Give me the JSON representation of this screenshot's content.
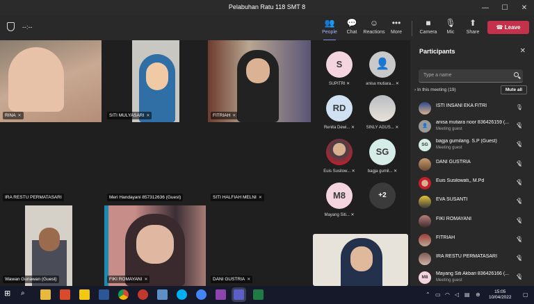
{
  "window": {
    "title": "Pelabuhan Ratu 118 SMT 8"
  },
  "toolbar": {
    "timer": "--:--",
    "people_label": "People",
    "chat_label": "Chat",
    "reactions_label": "Reactions",
    "more_label": "More",
    "camera_label": "Camera",
    "mic_label": "Mic",
    "share_label": "Share",
    "leave_label": "Leave"
  },
  "grid": {
    "tiles": [
      {
        "name": "RINA"
      },
      {
        "name": "SITI MULYASARI"
      },
      {
        "name": "FITRIAH"
      },
      {
        "name": "IRA RESTU PERMATASARI"
      },
      {
        "name": "Meri Handayani 857312636 (Guest)"
      },
      {
        "name": "SITI HALFIAH MELNI"
      },
      {
        "name": "Wawan Gunawan (Guest)"
      },
      {
        "name": "FIKI ROMAYANI"
      },
      {
        "name": "DANI GUSTRIA"
      }
    ]
  },
  "avatars": [
    {
      "initials": "S",
      "name": "SUPITRI",
      "color": "#f3d4df"
    },
    {
      "initials": "",
      "name": "anisa mutiara...",
      "color": "#c9c9c9"
    },
    {
      "initials": "RD",
      "name": "Renita Dewi...",
      "color": "#cfe1f3"
    },
    {
      "initials": "",
      "name": "SINLY AGUS...",
      "color": "#c9c9c9"
    },
    {
      "initials": "",
      "name": "Euis Susilow...",
      "color": "#c9c9c9"
    },
    {
      "initials": "SG",
      "name": "bagja gumil...",
      "color": "#d6ece6"
    },
    {
      "initials": "M8",
      "name": "Mayang Siti...",
      "color": "#f3d4df"
    },
    {
      "initials": "+2",
      "name": "",
      "color": "#3b3b3b"
    }
  ],
  "panel": {
    "title": "Participants",
    "search_placeholder": "Type a name",
    "section_label": "In this meeting (19)",
    "mute_all_label": "Mute all",
    "participants": [
      {
        "name": "ISTI INSANI EKA FITRI",
        "sub": "",
        "initials": "",
        "mic": "on"
      },
      {
        "name": "anisa mutiara noor 836426159 (...",
        "sub": "Meeting guest",
        "initials": "",
        "mic": "off"
      },
      {
        "name": "bagja gumilang. S.P (Guest)",
        "sub": "Meeting guest",
        "initials": "SG",
        "mic": "off"
      },
      {
        "name": "DANI GUSTRIA",
        "sub": "",
        "initials": "",
        "mic": "off"
      },
      {
        "name": "Euis Susilowati,, M.Pd",
        "sub": "",
        "initials": "",
        "mic": "off"
      },
      {
        "name": "EVA SUSANTI",
        "sub": "",
        "initials": "",
        "mic": "off"
      },
      {
        "name": "FIKI ROMAYANI",
        "sub": "",
        "initials": "",
        "mic": "off"
      },
      {
        "name": "FITRIAH",
        "sub": "",
        "initials": "",
        "mic": "off"
      },
      {
        "name": "IRA RESTU PERMATASARI",
        "sub": "",
        "initials": "",
        "mic": "off"
      },
      {
        "name": "Mayang Siti Akbari 836426166 (...",
        "sub": "Meeting guest",
        "initials": "M8",
        "mic": "off"
      }
    ]
  },
  "taskbar": {
    "time": "15:05",
    "date": "10/04/2022"
  }
}
